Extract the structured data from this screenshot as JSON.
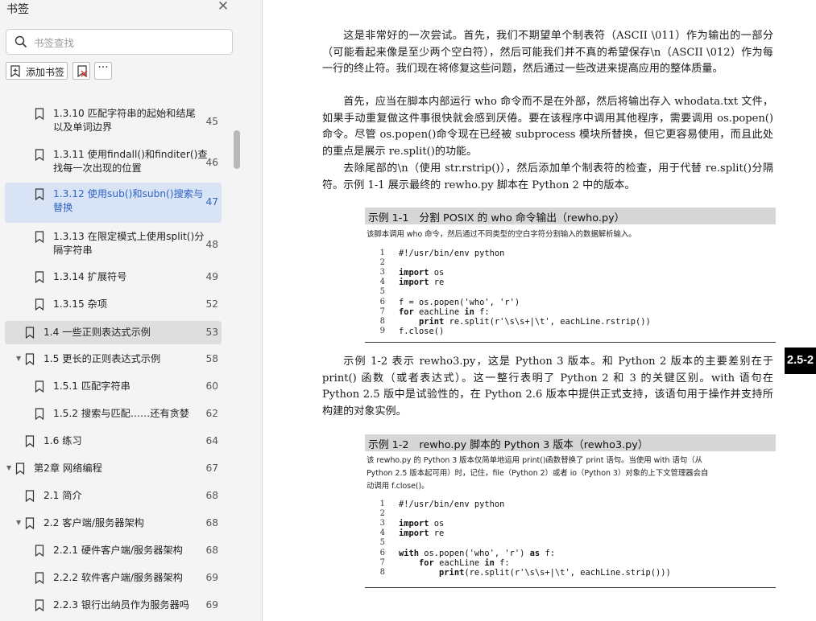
{
  "sidebar": {
    "title": "书签",
    "search_placeholder": "书签查找",
    "add_button_label": "添加书签",
    "more_label": "···",
    "items": [
      {
        "label": "1.3.10 匹配字符串的起始和结尾以及单词边界",
        "lines": [
          "1.3.10 匹配字符串的起始和结尾",
          "以及单词边界"
        ],
        "page": "45",
        "level": 2,
        "expanded": null,
        "state": "normal"
      },
      {
        "label": "1.3.11 使用findall()和finditer()查找每一次出现的位置",
        "lines": [
          "1.3.11 使用findall()和finditer()查",
          "找每一次出现的位置"
        ],
        "page": "46",
        "level": 2,
        "expanded": null,
        "state": "normal"
      },
      {
        "label": "1.3.12 使用sub()和subn()搜索与替换",
        "lines": [
          "1.3.12 使用sub()和subn()搜索与",
          "替换"
        ],
        "page": "47",
        "level": 2,
        "expanded": null,
        "state": "selected"
      },
      {
        "label": "1.3.13 在限定模式上使用split()分隔字符串",
        "lines": [
          "1.3.13 在限定模式上使用split()分",
          "隔字符串"
        ],
        "page": "48",
        "level": 2,
        "expanded": null,
        "state": "normal"
      },
      {
        "label": "1.3.14 扩展符号",
        "lines": [
          "1.3.14 扩展符号"
        ],
        "page": "49",
        "level": 2,
        "expanded": null,
        "state": "normal"
      },
      {
        "label": "1.3.15 杂项",
        "lines": [
          "1.3.15 杂项"
        ],
        "page": "52",
        "level": 2,
        "expanded": null,
        "state": "normal"
      },
      {
        "label": "1.4 一些正则表达式示例",
        "lines": [
          "1.4 一些正则表达式示例"
        ],
        "page": "53",
        "level": 1,
        "expanded": null,
        "state": "hover"
      },
      {
        "label": "1.5 更长的正则表达式示例",
        "lines": [
          "1.5 更长的正则表达式示例"
        ],
        "page": "58",
        "level": 1,
        "expanded": true,
        "state": "normal"
      },
      {
        "label": "1.5.1 匹配字符串",
        "lines": [
          "1.5.1 匹配字符串"
        ],
        "page": "60",
        "level": 2,
        "expanded": null,
        "state": "normal"
      },
      {
        "label": "1.5.2 搜索与匹配……还有贪婪",
        "lines": [
          "1.5.2 搜索与匹配……还有贪婪"
        ],
        "page": "62",
        "level": 2,
        "expanded": null,
        "state": "normal"
      },
      {
        "label": "1.6 练习",
        "lines": [
          "1.6 练习"
        ],
        "page": "64",
        "level": 1,
        "expanded": null,
        "state": "normal"
      },
      {
        "label": "第2章 网络编程",
        "lines": [
          "第2章 网络编程"
        ],
        "page": "67",
        "level": 0,
        "expanded": true,
        "state": "normal"
      },
      {
        "label": "2.1 简介",
        "lines": [
          "2.1 简介"
        ],
        "page": "68",
        "level": 1,
        "expanded": null,
        "state": "normal"
      },
      {
        "label": "2.2 客户端/服务器架构",
        "lines": [
          "2.2 客户端/服务器架构"
        ],
        "page": "68",
        "level": 1,
        "expanded": true,
        "state": "normal"
      },
      {
        "label": "2.2.1 硬件客户端/服务器架构",
        "lines": [
          "2.2.1 硬件客户端/服务器架构"
        ],
        "page": "68",
        "level": 2,
        "expanded": null,
        "state": "normal"
      },
      {
        "label": "2.2.2 软件客户端/服务器架构",
        "lines": [
          "2.2.2 软件客户端/服务器架构"
        ],
        "page": "69",
        "level": 2,
        "expanded": null,
        "state": "normal"
      },
      {
        "label": "2.2.3 银行出纳员作为服务器吗",
        "lines": [
          "2.2.3 银行出纳员作为服务器吗"
        ],
        "page": "69",
        "level": 2,
        "expanded": null,
        "state": "normal"
      }
    ]
  },
  "document": {
    "paragraphs": [
      "这是非常好的一次尝试。首先，我们不期望单个制表符（ASCII \\011）作为输出的一部分（可能看起来像是至少两个空白符），然后可能我们并不真的希望保存\\n（ASCII \\012）作为每一行的终止符。我们现在将修复这些问题，然后通过一些改进来提高应用的整体质量。",
      "首先，应当在脚本内部运行 who 命令而不是在外部，然后将输出存入 whodata.txt 文件，如果手动重复做这件事很快就会感到厌倦。要在该程序中调用其他程序，需要调用 os.popen() 命令。尽管 os.popen()命令现在已经被 subprocess 模块所替换，但它更容易使用，而且此处的重点是展示 re.split()的功能。",
      "去除尾部的\\n（使用 str.rstrip()），然后添加单个制表符的检查，用于代替 re.split()分隔符。示例 1-1 展示最终的 rewho.py 脚本在 Python 2 中的版本。",
      "示例 1-2 表示 rewho3.py，这是 Python 3 版本。和 Python 2 版本的主要差别在于 print() 函数（或者表达式）。这一整行表明了 Python 2 和 3 的关键区别。with 语句在 Python 2.5 版中是试验性的，在 Python 2.6 版本中提供正式支持，该语句用于操作并支持所构建的对象实例。"
    ],
    "example1": {
      "title": "示例 1-1　分割 POSIX 的 who 命令输出（rewho.py）",
      "description": "该脚本调用 who 命令，然后通过不同类型的空白字符分割输入的数据解析输入。",
      "code": [
        {
          "n": "1",
          "text": "#!/usr/bin/env python"
        },
        {
          "n": "2",
          "text": ""
        },
        {
          "n": "3",
          "text": "import os"
        },
        {
          "n": "4",
          "text": "import re"
        },
        {
          "n": "5",
          "text": ""
        },
        {
          "n": "6",
          "text": "f = os.popen('who', 'r')"
        },
        {
          "n": "7",
          "text": "for eachLine in f:"
        },
        {
          "n": "8",
          "text": "    print re.split(r'\\s\\s+|\\t', eachLine.rstrip())"
        },
        {
          "n": "9",
          "text": "f.close()"
        }
      ]
    },
    "example2": {
      "title": "示例 1-2　rewho.py 脚本的 Python 3 版本（rewho3.py）",
      "description_lines": [
        "该 rewho.py 的 Python 3 版本仅简单地运用 print()函数替换了 print 语句。当使用 with 语句（从",
        "Python 2.5 版本起可用）时，记住，file（Python 2）或者 io（Python 3）对象的上下文管理器会自",
        "动调用 f.close()。"
      ],
      "code": [
        {
          "n": "1",
          "text": "#!/usr/bin/env python"
        },
        {
          "n": "2",
          "text": ""
        },
        {
          "n": "3",
          "text": "import os"
        },
        {
          "n": "4",
          "text": "import re"
        },
        {
          "n": "5",
          "text": ""
        },
        {
          "n": "6",
          "text": "with os.popen('who', 'r') as f:"
        },
        {
          "n": "7",
          "text": "    for eachLine in f:"
        },
        {
          "n": "8",
          "text": "        print(re.split(r'\\s\\s+|\\t', eachLine.strip()))"
        }
      ]
    },
    "side_tab": "2.5-2"
  },
  "colors": {
    "sidebar_bg": "#f4f4f4",
    "selected_bg": "#d8e4f6",
    "selected_text": "#2f63c4",
    "hover_bg": "#dedede",
    "example_header_bg": "#d6d6d6",
    "side_tab_bg": "#000000"
  }
}
